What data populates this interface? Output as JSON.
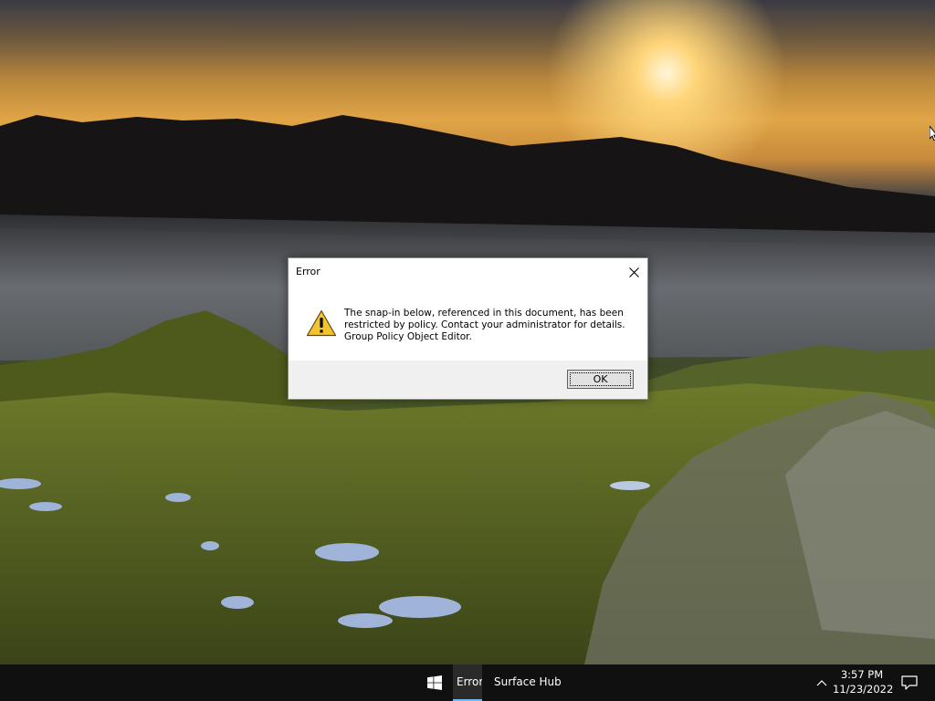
{
  "dialog": {
    "title": "Error",
    "message_lines": [
      "The snap-in below, referenced in this document, has been",
      "restricted by policy. Contact your administrator for details.",
      "Group Policy Object Editor."
    ],
    "ok_label": "OK",
    "icon": "warning-icon",
    "close_icon": "close-icon"
  },
  "taskbar": {
    "start_icon": "windows-logo-icon",
    "tasks": [
      {
        "label": "Error",
        "active": true
      },
      {
        "label": "Surface Hub",
        "active": false
      }
    ],
    "tray_icon": "chevron-up-icon",
    "clock": {
      "time": "3:57 PM",
      "date": "11/23/2022"
    },
    "notification_icon": "action-center-icon"
  },
  "colors": {
    "taskbar_bg": "#101010",
    "accent": "#0078d7",
    "active_task_underline": "#76b9ed",
    "warning_yellow": "#f4c430"
  }
}
